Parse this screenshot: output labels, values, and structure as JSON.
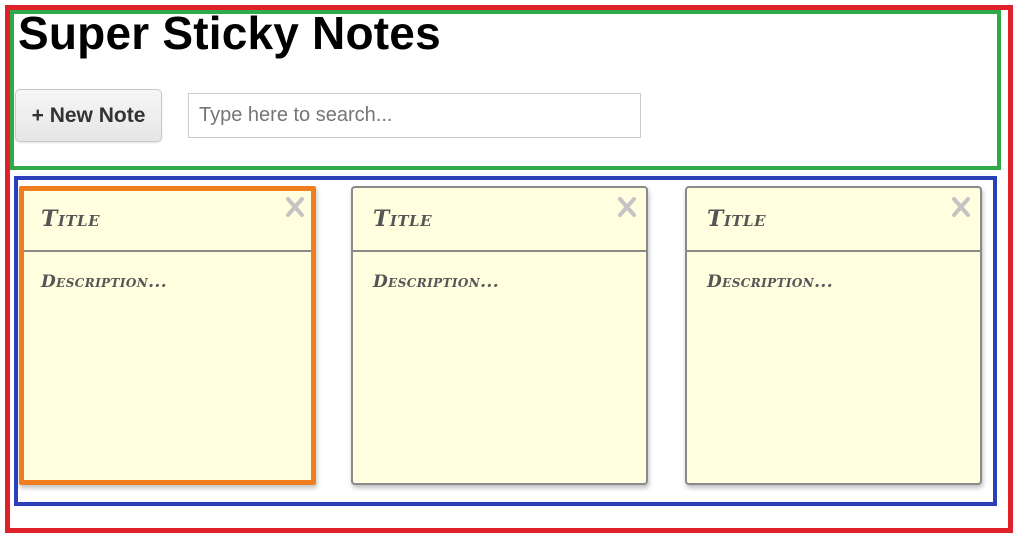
{
  "header": {
    "title": "Super Sticky Notes",
    "new_note_label": "+ New Note",
    "search": {
      "placeholder": "Type here to search...",
      "value": ""
    }
  },
  "colors": {
    "note_background": "#ffffe0",
    "selected_outline": "#f07d1e",
    "header_outline": "#2eaa4a",
    "board_outline": "#2b3fb8",
    "page_outline": "#e0202a"
  },
  "notes": [
    {
      "title": "Title",
      "description": "Description...",
      "close_icon": "close-icon",
      "selected": true
    },
    {
      "title": "Title",
      "description": "Description...",
      "close_icon": "close-icon",
      "selected": false
    },
    {
      "title": "Title",
      "description": "Description...",
      "close_icon": "close-icon",
      "selected": false
    }
  ]
}
